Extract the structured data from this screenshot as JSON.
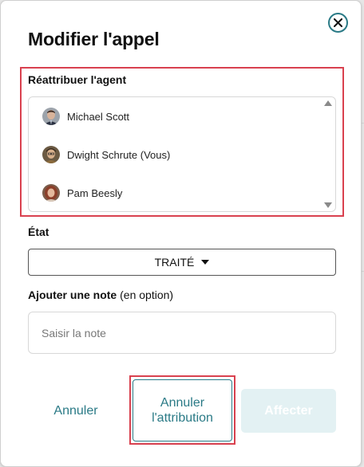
{
  "modal": {
    "title": "Modifier l'appel"
  },
  "reassign": {
    "label": "Réattribuer l'agent",
    "agents": [
      {
        "name": "Michael Scott",
        "avatar": "michael-avatar"
      },
      {
        "name": "Dwight Schrute (Vous)",
        "avatar": "dwight-avatar"
      },
      {
        "name": "Pam Beesly",
        "avatar": "pam-avatar"
      }
    ]
  },
  "status": {
    "label": "État",
    "value": "TRAITÉ"
  },
  "note": {
    "label": "Ajouter une note",
    "optional": "(en option)",
    "placeholder": "Saisir la note"
  },
  "actions": {
    "cancel": "Annuler",
    "unassign": "Annuler l'attribution",
    "assign": "Affecter"
  },
  "icons": {
    "close": "close-icon",
    "dropdown": "caret-down-icon",
    "scroll_up": "scroll-up-arrow",
    "scroll_down": "scroll-down-arrow"
  },
  "colors": {
    "accent": "#2a7a86",
    "highlight": "#d9414f",
    "assign_disabled_bg": "#e3f1f3"
  }
}
